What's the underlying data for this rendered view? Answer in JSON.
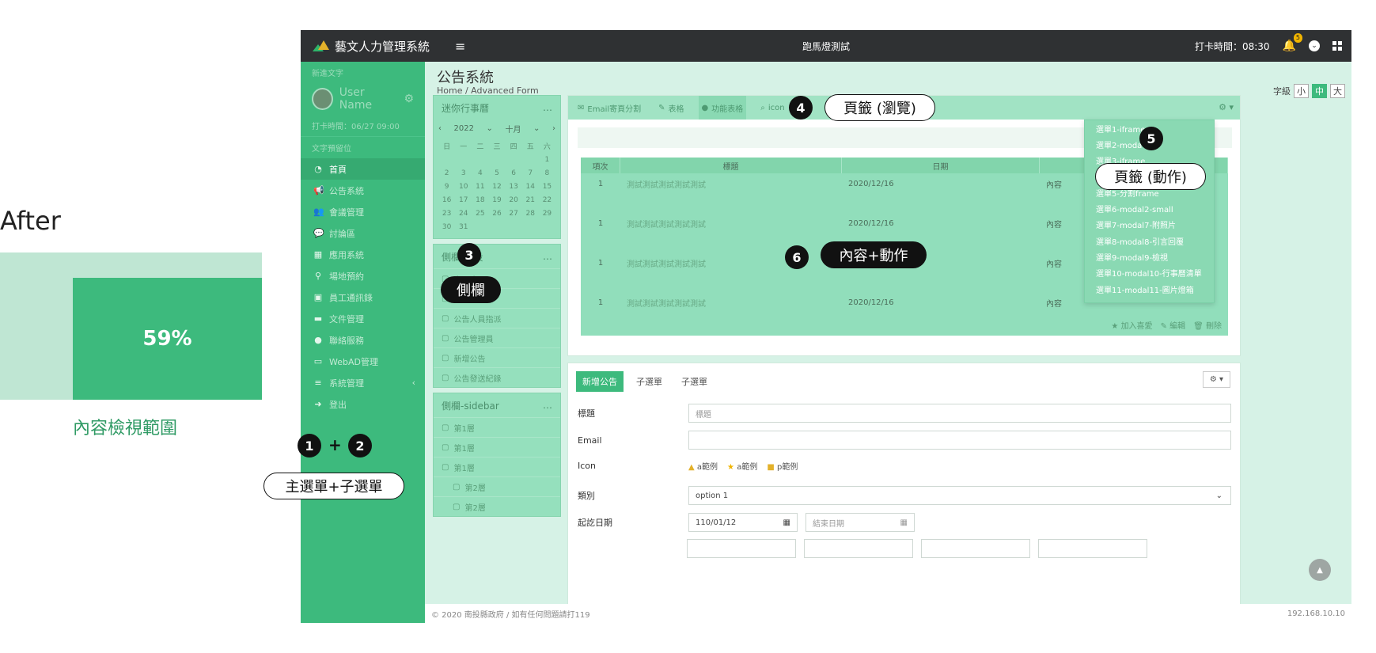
{
  "after": {
    "label": "After",
    "percent": "59%",
    "caption": "內容檢視範圍",
    "view_fraction": 0.59
  },
  "topbar": {
    "brand": "藝文人力管理系統",
    "center_title": "跑馬燈測試",
    "clock": "打卡時間：08:30",
    "bell_badge": "5"
  },
  "sidebar": {
    "news_label": "新進文字",
    "user_name": "User Name",
    "clock_time": "打卡時間：06/27 09:00",
    "text_section": "文字預留位",
    "items": [
      {
        "label": "首頁",
        "icon": "dashboard-icon"
      },
      {
        "label": "公告系統",
        "icon": "megaphone-icon"
      },
      {
        "label": "會議管理",
        "icon": "users-icon"
      },
      {
        "label": "討論區",
        "icon": "comments-icon"
      },
      {
        "label": "應用系統",
        "icon": "grid-icon"
      },
      {
        "label": "場地預約",
        "icon": "map-marker-icon"
      },
      {
        "label": "員工通訊錄",
        "icon": "contact-book-icon"
      },
      {
        "label": "文件管理",
        "icon": "folder-icon"
      },
      {
        "label": "聯絡服務",
        "icon": "chat-icon"
      },
      {
        "label": "WebAD管理",
        "icon": "monitor-icon"
      },
      {
        "label": "系統管理",
        "icon": "database-icon"
      },
      {
        "label": "登出",
        "icon": "logout-icon"
      }
    ]
  },
  "main": {
    "title": "公告系統",
    "breadcrumb": "Home / Advanced Form",
    "font_size_label": "字級",
    "font_sizes": [
      "小",
      "中",
      "大"
    ]
  },
  "widgets": {
    "mini_calendar": {
      "title": "迷你行事曆",
      "year": "2022",
      "month": "十月",
      "weekdays": [
        "日",
        "一",
        "二",
        "三",
        "四",
        "五",
        "六"
      ],
      "days": [
        "",
        "",
        "",
        "",
        "",
        "",
        "1",
        "2",
        "3",
        "4",
        "5",
        "6",
        "7",
        "8",
        "9",
        "10",
        "11",
        "12",
        "13",
        "14",
        "15",
        "16",
        "17",
        "18",
        "19",
        "20",
        "21",
        "22",
        "23",
        "24",
        "25",
        "26",
        "27",
        "28",
        "29",
        "30",
        "31"
      ]
    },
    "side_default": {
      "title": "側欄-預設",
      "links": [
        "上下班",
        "公告設定",
        "公告人員指派",
        "公告管理員",
        "新增公告",
        "公告發送紀錄"
      ]
    },
    "side_sidebar": {
      "title": "側欄-sidebar",
      "links": [
        "第1層",
        "第1層",
        "第1層",
        "第2層",
        "第2層"
      ]
    }
  },
  "content": {
    "tabs": [
      "Email寄頁分割",
      "表格",
      "功能表格",
      "icon"
    ],
    "table_headers": [
      "項次",
      "標題",
      "日期",
      ""
    ],
    "rows": [
      {
        "idx": "1",
        "title": "測試測試測試測試測試",
        "date": "2020/12/16",
        "col4": "內容"
      },
      {
        "idx": "1",
        "title": "測試測試測試測試測試",
        "date": "2020/12/16",
        "col4": "內容"
      },
      {
        "idx": "1",
        "title": "測試測試測試測試測試",
        "date": "2020",
        "col4": "內容"
      },
      {
        "idx": "1",
        "title": "測試測試測試測試測試",
        "date": "2020/12/16",
        "col4": "內容"
      }
    ],
    "footer_actions": [
      "加入喜愛",
      "編輯",
      "刪除"
    ]
  },
  "dropdown": {
    "items": [
      "選單1-iframe",
      "選單2-moda",
      "選單3-iframe",
      "",
      "選單5-分割frame",
      "選單6-modal2-small",
      "選單7-modal7-附照片",
      "選單8-modal8-引言回覆",
      "選單9-modal9-檢視",
      "選單10-modal10-行事曆清單",
      "選單11-modal11-圖片燈箱"
    ]
  },
  "form": {
    "tabs": [
      "新增公告",
      "子選單",
      "子選單"
    ],
    "fields": {
      "title_label": "標題",
      "title_placeholder": "標題",
      "email_label": "Email",
      "icon_label": "Icon",
      "icon_examples": [
        "a範例",
        "a範例",
        "p範例"
      ],
      "category_label": "類別",
      "category_value": "option 1",
      "date_label": "起訖日期",
      "start_date": "110/01/12",
      "end_placeholder": "結束日期"
    }
  },
  "footer": {
    "left": "© 2020 南投縣政府 / 如有任何問題請打119",
    "right": "192.168.10.10"
  },
  "annotations": {
    "n1": "1",
    "n2": "2",
    "plus": "+",
    "menu_pill": "主選單+子選單",
    "n3": "3",
    "sidebar_pill": "側欄",
    "n4": "4",
    "tabs_browse_pill": "頁籤 (瀏覽)",
    "n5": "5",
    "tabs_action_pill": "頁籤 (動作)",
    "n6": "6",
    "content_pill": "內容+動作"
  }
}
